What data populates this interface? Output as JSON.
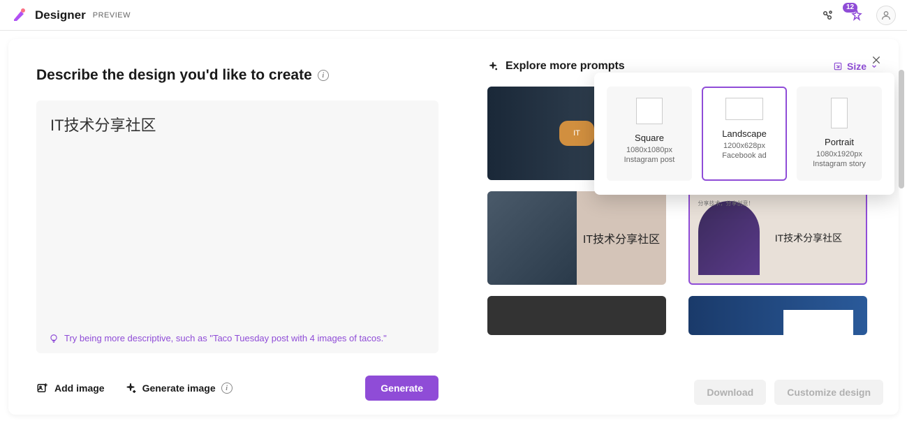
{
  "header": {
    "app_name": "Designer",
    "preview_label": "PREVIEW",
    "notification_count": "12"
  },
  "left": {
    "title": "Describe the design you'd like to create",
    "prompt_value": "IT技术分享社区",
    "hint": "Try being more descriptive, such as \"Taco Tuesday post with 4 images of tacos.\"",
    "add_image_label": "Add image",
    "generate_image_label": "Generate image",
    "generate_button": "Generate"
  },
  "right": {
    "explore_label": "Explore more prompts",
    "size_button": "Size",
    "thumb3_text": "IT技术分享社区",
    "thumb4_caption": "分享技术，分享创意！",
    "thumb4_text": "IT技术分享社区"
  },
  "size_popover": {
    "options": [
      {
        "label": "Square",
        "dims": "1080x1080px",
        "desc": "Instagram post"
      },
      {
        "label": "Landscape",
        "dims": "1200x628px",
        "desc": "Facebook ad"
      },
      {
        "label": "Portrait",
        "dims": "1080x1920px",
        "desc": "Instagram story"
      }
    ]
  },
  "bottom": {
    "download": "Download",
    "customize": "Customize design"
  }
}
